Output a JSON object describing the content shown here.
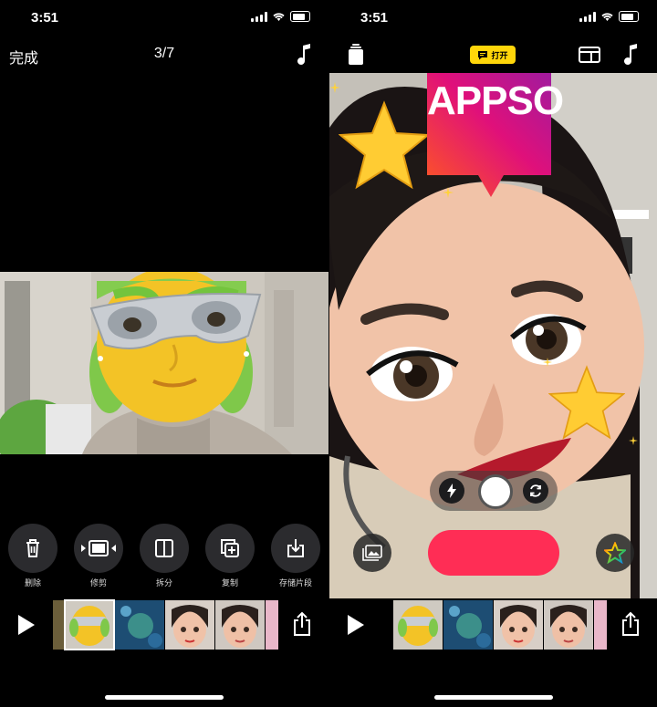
{
  "left": {
    "status": {
      "time": "3:51"
    },
    "header": {
      "done_label": "完成",
      "counter": "3/7"
    },
    "tools": [
      {
        "label": "删除",
        "icon": "trash-icon"
      },
      {
        "label": "修剪",
        "icon": "trim-icon"
      },
      {
        "label": "拆分",
        "icon": "split-icon"
      },
      {
        "label": "复制",
        "icon": "duplicate-icon"
      },
      {
        "label": "存储片段",
        "icon": "save-clip-icon"
      }
    ]
  },
  "right": {
    "status": {
      "time": "3:51"
    },
    "header": {
      "caption_toggle": "打开"
    },
    "sticker": {
      "text": "APPSO"
    }
  },
  "colors": {
    "record": "#ff2d55",
    "caption_toggle": "#ffd60a",
    "sticker_gradient": [
      "#ff5a1f",
      "#e0107a",
      "#a01a9e"
    ]
  }
}
